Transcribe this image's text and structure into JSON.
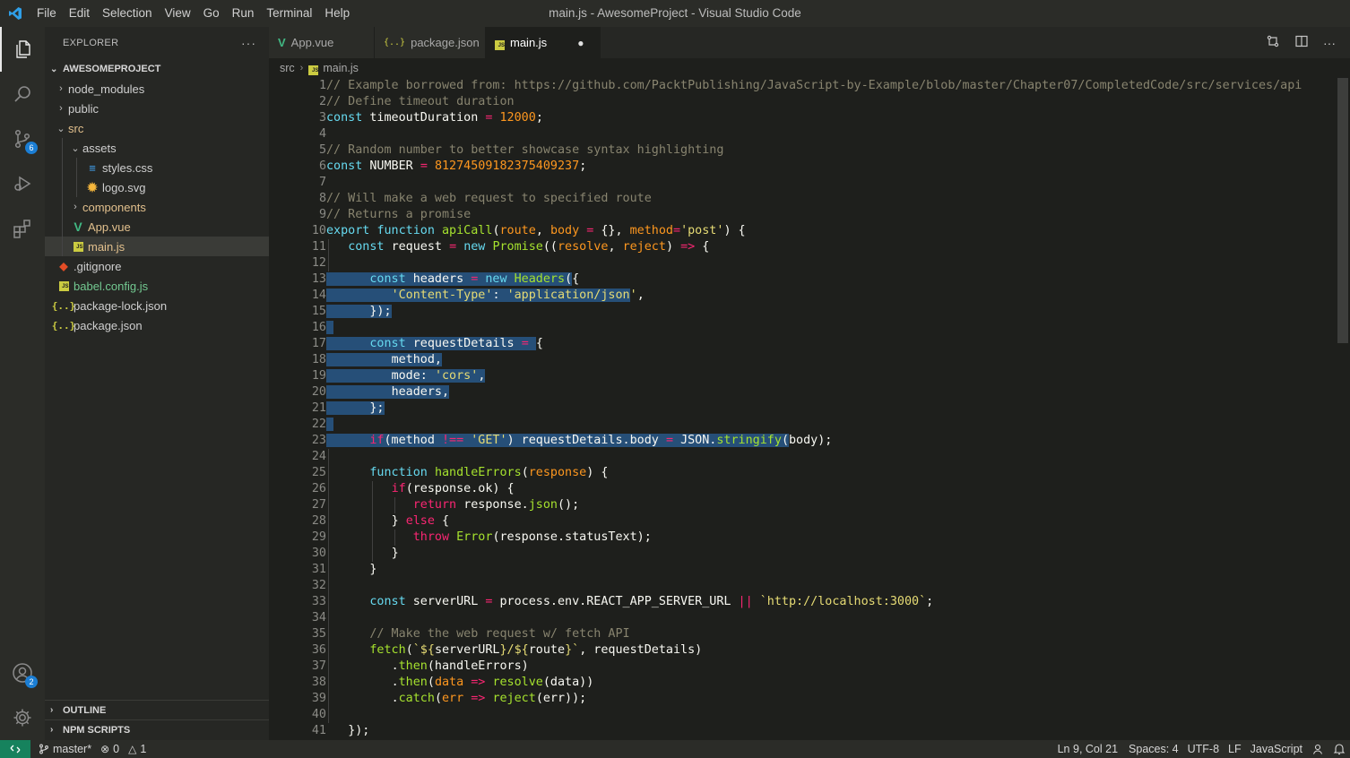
{
  "titlebar": {
    "menu": [
      "File",
      "Edit",
      "Selection",
      "View",
      "Go",
      "Run",
      "Terminal",
      "Help"
    ],
    "title": "main.js - AwesomeProject - Visual Studio Code"
  },
  "activity": {
    "scm_badge": "6",
    "accounts_badge": "2"
  },
  "explorer": {
    "header": "EXPLORER",
    "more": "···",
    "project": "AWESOMEPROJECT",
    "items": [
      {
        "label": "node_modules"
      },
      {
        "label": "public"
      },
      {
        "label": "src"
      },
      {
        "label": "assets"
      },
      {
        "label": "styles.css"
      },
      {
        "label": "logo.svg"
      },
      {
        "label": "components"
      },
      {
        "label": "App.vue"
      },
      {
        "label": "main.js"
      },
      {
        "label": ".gitignore"
      },
      {
        "label": "babel.config.js"
      },
      {
        "label": "package-lock.json"
      },
      {
        "label": "package.json"
      }
    ],
    "outline": "OUTLINE",
    "npm_scripts": "NPM SCRIPTS"
  },
  "tabs": [
    {
      "label": "App.vue"
    },
    {
      "label": "package.json"
    },
    {
      "label": "main.js"
    }
  ],
  "breadcrumb": {
    "folder": "src",
    "file": "main.js"
  },
  "editor": {
    "line_numbers": [
      "1",
      "2",
      "3",
      "4",
      "5",
      "6",
      "7",
      "8",
      "9",
      "10",
      "11",
      "12",
      "13",
      "14",
      "15",
      "16",
      "17",
      "18",
      "19",
      "20",
      "21",
      "22",
      "23",
      "24",
      "25",
      "26",
      "27",
      "28",
      "29",
      "30",
      "31",
      "32",
      "33",
      "34",
      "35",
      "36",
      "37",
      "38",
      "39",
      "40",
      "41"
    ]
  },
  "statusbar": {
    "branch": "master*",
    "errors": "0",
    "warnings": "1",
    "position": "Ln 9, Col 21",
    "spaces": "Spaces: 4",
    "encoding": "UTF-8",
    "eol": "LF",
    "language": "JavaScript"
  },
  "colors": {
    "accent": "#1b7ed4",
    "remote": "#16825d",
    "selection": "#264f78"
  }
}
